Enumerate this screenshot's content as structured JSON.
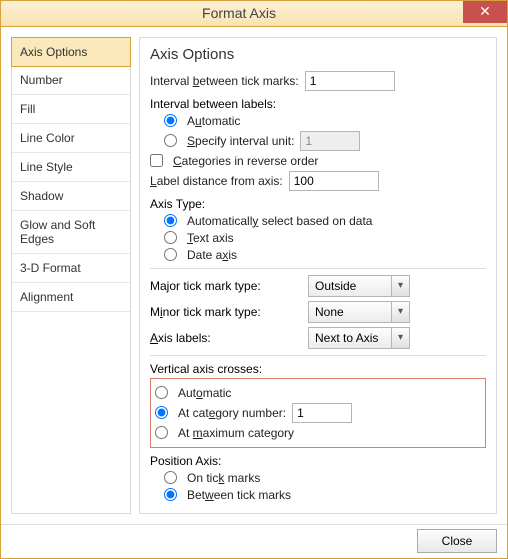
{
  "window": {
    "title": "Format Axis"
  },
  "sidebar": {
    "items": [
      "Axis Options",
      "Number",
      "Fill",
      "Line Color",
      "Line Style",
      "Shadow",
      "Glow and Soft Edges",
      "3-D Format",
      "Alignment"
    ],
    "selected": 0
  },
  "content": {
    "heading": "Axis Options",
    "interval_ticks_label": "Interval between tick marks:",
    "interval_ticks_value": "1",
    "interval_labels_label": "Interval between labels:",
    "interval_labels_auto": "Automatic",
    "interval_labels_specify": "Specify interval unit:",
    "interval_labels_specify_value": "1",
    "reverse_label": "Categories in reverse order",
    "label_distance_label": "Label distance from axis:",
    "label_distance_value": "100",
    "axis_type_label": "Axis Type:",
    "axis_type_auto": "Automatically select based on data",
    "axis_type_text": "Text axis",
    "axis_type_date": "Date axis",
    "major_tick_label": "Major tick mark type:",
    "major_tick_value": "Outside",
    "minor_tick_label": "Minor tick mark type:",
    "minor_tick_value": "None",
    "axis_labels_label": "Axis labels:",
    "axis_labels_value": "Next to Axis",
    "vax_label": "Vertical axis crosses:",
    "vax_auto": "Automatic",
    "vax_cat": "At category number:",
    "vax_cat_value": "1",
    "vax_max": "At maximum category",
    "pos_label": "Position Axis:",
    "pos_ontick": "On tick marks",
    "pos_between": "Between tick marks"
  },
  "footer": {
    "close": "Close"
  }
}
